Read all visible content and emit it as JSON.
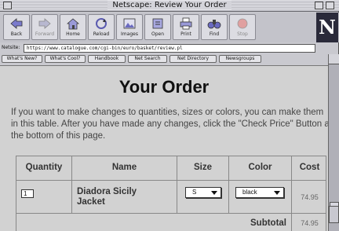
{
  "window": {
    "title": "Netscape: Review Your Order"
  },
  "toolbar": {
    "buttons": [
      {
        "label": "Back"
      },
      {
        "label": "Forward"
      },
      {
        "label": "Home"
      },
      {
        "label": "Reload"
      },
      {
        "label": "Images"
      },
      {
        "label": "Open"
      },
      {
        "label": "Print"
      },
      {
        "label": "Find"
      },
      {
        "label": "Stop"
      }
    ],
    "logo_letter": "N"
  },
  "location": {
    "label": "Netsite:",
    "url": "https://www.catalogue.com/cgi-bin/euro/basket/review.pl"
  },
  "directory": {
    "buttons": [
      {
        "label": "What's New?"
      },
      {
        "label": "What's Cool?"
      },
      {
        "label": "Handbook"
      },
      {
        "label": "Net Search"
      },
      {
        "label": "Net Directory"
      },
      {
        "label": "Newsgroups"
      }
    ]
  },
  "page": {
    "title": "Your Order",
    "intro": "If you want to make changes to quantities, sizes or colors, you can make them in this table. After you have made any changes, click the \"Check Price\" Button at the bottom of this page.",
    "table": {
      "headers": [
        "Quantity",
        "Name",
        "Size",
        "Color",
        "Cost"
      ],
      "rows": [
        {
          "quantity": "1",
          "name_line1": "Diadora Sicily",
          "name_line2": "Jacket",
          "size": "S",
          "color": "black",
          "cost": "74.95"
        }
      ],
      "subtotal_label": "Subtotal",
      "subtotal_value": "74.95"
    }
  }
}
